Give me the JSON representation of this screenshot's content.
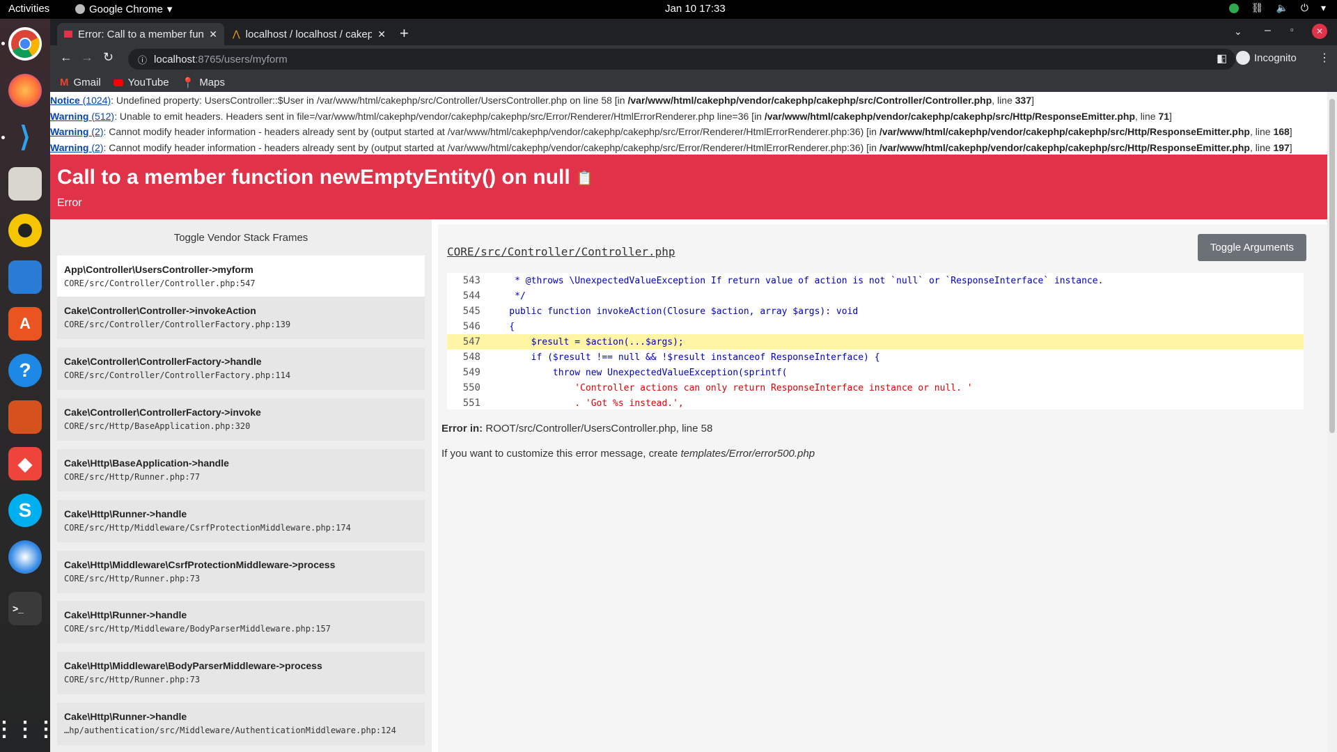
{
  "topbar": {
    "activities": "Activities",
    "app_name": "Google Chrome",
    "clock": "Jan 10  17:33"
  },
  "dock": {
    "items": [
      "chrome-icon",
      "firefox-icon",
      "vscode-icon",
      "files-icon",
      "rhythmbox-icon",
      "writer-icon",
      "software-icon",
      "help-icon",
      "impress-icon",
      "anydesk-icon",
      "skype-icon",
      "thunderbird-icon",
      "terminal-icon",
      "apps-grid-icon"
    ]
  },
  "chrome": {
    "tabs": [
      {
        "title": "Error: Call to a member function newEmptyEntity() on null"
      },
      {
        "title": "localhost / localhost / cakephp"
      }
    ],
    "url_host": "localhost",
    "url_rest": ":8765/users/myform",
    "incognito_label": "Incognito",
    "bookmarks": [
      {
        "label": "Gmail"
      },
      {
        "label": "YouTube"
      },
      {
        "label": "Maps"
      }
    ]
  },
  "warnings": [
    {
      "type": "Notice",
      "code": "(1024)",
      "text": ": Undefined property: UsersController::$User in /var/www/html/cakephp/src/Controller/UsersController.php on line 58 [in ",
      "path": "/var/www/html/cakephp/vendor/cakephp/cakephp/src/Controller/Controller.php",
      "line_prefix": ", line ",
      "line": "337",
      "close": "]"
    },
    {
      "type": "Warning",
      "code": "(512)",
      "text": ": Unable to emit headers. Headers sent in file=/var/www/html/cakephp/vendor/cakephp/cakephp/src/Error/Renderer/HtmlErrorRenderer.php line=36 [in ",
      "path": "/var/www/html/cakephp/vendor/cakephp/cakephp/src/Http/ResponseEmitter.php",
      "line_prefix": ", line ",
      "line": "71",
      "close": "]"
    },
    {
      "type": "Warning",
      "code": "(2)",
      "text": ": Cannot modify header information - headers already sent by (output started at /var/www/html/cakephp/vendor/cakephp/cakephp/src/Error/Renderer/HtmlErrorRenderer.php:36) [in ",
      "path": "/var/www/html/cakephp/vendor/cakephp/cakephp/src/Http/ResponseEmitter.php",
      "line_prefix": ", line ",
      "line": "168",
      "close": "]"
    },
    {
      "type": "Warning",
      "code": "(2)",
      "text": ": Cannot modify header information - headers already sent by (output started at /var/www/html/cakephp/vendor/cakephp/cakephp/src/Error/Renderer/HtmlErrorRenderer.php:36) [in ",
      "path": "/var/www/html/cakephp/vendor/cakephp/cakephp/src/Http/ResponseEmitter.php",
      "line_prefix": ", line ",
      "line": "197",
      "close": "]"
    }
  ],
  "error": {
    "title": "Call to a member function newEmptyEntity() on null",
    "subtitle": "Error"
  },
  "stack": {
    "toggle_label": "Toggle Vendor Stack Frames",
    "frames": [
      {
        "fn": "App\\Controller\\UsersController->myform",
        "loc": "CORE/src/Controller/Controller.php:547"
      },
      {
        "fn": "Cake\\Controller\\Controller->invokeAction",
        "loc": "CORE/src/Controller/ControllerFactory.php:139"
      },
      {
        "fn": "Cake\\Controller\\ControllerFactory->handle",
        "loc": "CORE/src/Controller/ControllerFactory.php:114"
      },
      {
        "fn": "Cake\\Controller\\ControllerFactory->invoke",
        "loc": "CORE/src/Http/BaseApplication.php:320"
      },
      {
        "fn": "Cake\\Http\\BaseApplication->handle",
        "loc": "CORE/src/Http/Runner.php:77"
      },
      {
        "fn": "Cake\\Http\\Runner->handle",
        "loc": "CORE/src/Http/Middleware/CsrfProtectionMiddleware.php:174"
      },
      {
        "fn": "Cake\\Http\\Middleware\\CsrfProtectionMiddleware->process",
        "loc": "CORE/src/Http/Runner.php:73"
      },
      {
        "fn": "Cake\\Http\\Runner->handle",
        "loc": "CORE/src/Http/Middleware/BodyParserMiddleware.php:157"
      },
      {
        "fn": "Cake\\Http\\Middleware\\BodyParserMiddleware->process",
        "loc": "CORE/src/Http/Runner.php:73"
      },
      {
        "fn": "Cake\\Http\\Runner->handle",
        "loc": "…hp/authentication/src/Middleware/AuthenticationMiddleware.php:124"
      }
    ]
  },
  "detail": {
    "file": "CORE/src/Controller/Controller.php",
    "toggle_args": "Toggle Arguments",
    "code": [
      {
        "n": "543",
        "text": "     * @throws \\UnexpectedValueException If return value of action is not `null` or `ResponseInterface` instance."
      },
      {
        "n": "544",
        "text": "     */"
      },
      {
        "n": "545",
        "text": "    public function invokeAction(Closure $action, array $args): void"
      },
      {
        "n": "546",
        "text": "    {"
      },
      {
        "n": "547",
        "text": "        $result = $action(...$args);"
      },
      {
        "n": "548",
        "text": "        if ($result !== null && !$result instanceof ResponseInterface) {"
      },
      {
        "n": "549",
        "text": "            throw new UnexpectedValueException(sprintf("
      },
      {
        "n": "550",
        "text": "                'Controller actions can only return ResponseInterface instance or null. '"
      },
      {
        "n": "551",
        "text": "                . 'Got %s instead.',"
      }
    ],
    "highlight_line": "547",
    "error_in_label": "Error in:",
    "error_in_value": " ROOT/src/Controller/UsersController.php, line 58",
    "custom_prefix": "If you want to customize this error message, create ",
    "custom_path": "templates/Error/error500.php"
  }
}
